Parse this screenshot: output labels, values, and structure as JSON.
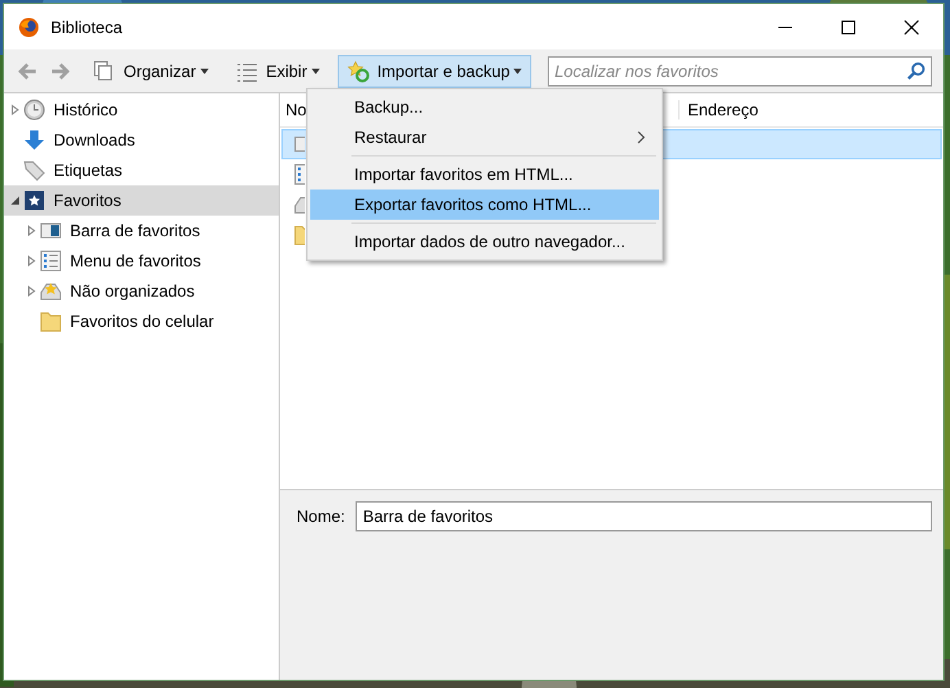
{
  "window": {
    "title": "Biblioteca"
  },
  "toolbar": {
    "back_disabled": true,
    "forward_disabled": true,
    "buttons": [
      {
        "kind": "organize",
        "label": "Organizar",
        "selected": false
      },
      {
        "kind": "view",
        "label": "Exibir",
        "selected": false
      },
      {
        "kind": "import",
        "label": "Importar e backup",
        "selected": true
      }
    ],
    "search": {
      "placeholder": "Localizar nos favoritos"
    }
  },
  "sidebar": {
    "items": [
      {
        "kind": "history",
        "label": "Histórico",
        "expandable": true,
        "expanded": false,
        "selected": false
      },
      {
        "kind": "downloads",
        "label": "Downloads",
        "expandable": false,
        "selected": false
      },
      {
        "kind": "tags",
        "label": "Etiquetas",
        "expandable": false,
        "selected": false
      },
      {
        "kind": "bookmarks",
        "label": "Favoritos",
        "expandable": true,
        "expanded": true,
        "selected": true,
        "children": [
          {
            "kind": "bar",
            "label": "Barra de favoritos",
            "expandable": true,
            "expanded": false,
            "selected": false
          },
          {
            "kind": "menu",
            "label": "Menu de favoritos",
            "expandable": true,
            "expanded": false,
            "selected": false
          },
          {
            "kind": "unsorted",
            "label": "Não organizados",
            "expandable": true,
            "expanded": false,
            "selected": false
          },
          {
            "kind": "folder",
            "label": "Favoritos do celular",
            "expandable": false,
            "selected": false
          }
        ]
      }
    ]
  },
  "table": {
    "columns": [
      "No",
      "Endereço"
    ],
    "rows": [
      {
        "kind": "bar",
        "selected": true
      },
      {
        "kind": "menu",
        "selected": false
      },
      {
        "kind": "unsorted",
        "selected": false
      },
      {
        "kind": "folder",
        "selected": false
      }
    ]
  },
  "menu": {
    "items": [
      {
        "kind": "item",
        "label": "Backup...",
        "submenu": false,
        "selected": false
      },
      {
        "kind": "item",
        "label": "Restaurar",
        "submenu": true,
        "selected": false
      },
      {
        "kind": "separator"
      },
      {
        "kind": "item",
        "label": "Importar favoritos em HTML...",
        "submenu": false,
        "selected": false
      },
      {
        "kind": "item",
        "label": "Exportar favoritos como HTML...",
        "submenu": false,
        "selected": true
      },
      {
        "kind": "separator"
      },
      {
        "kind": "item",
        "label": "Importar dados de outro navegador...",
        "submenu": false,
        "selected": false
      }
    ]
  },
  "details": {
    "name_label": "Nome:",
    "name_value": "Barra de favoritos"
  }
}
